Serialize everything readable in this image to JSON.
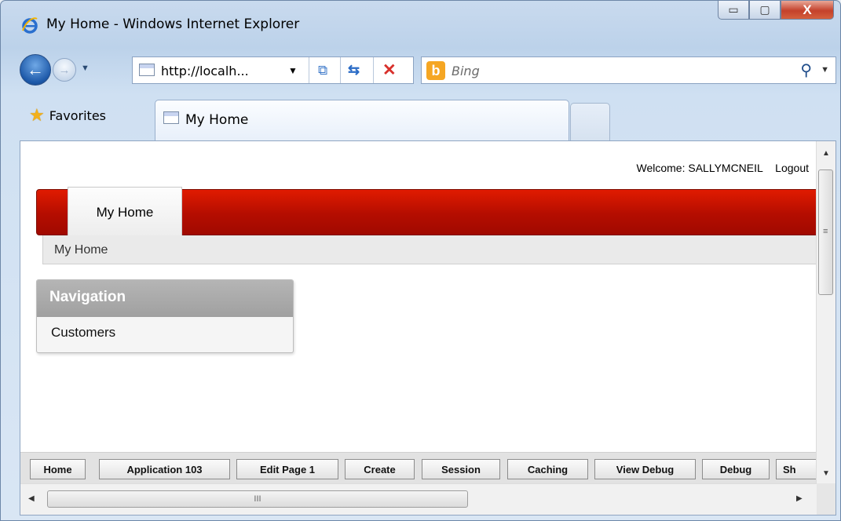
{
  "window": {
    "title": "My Home - Windows Internet Explorer",
    "controls": {
      "minimize": "▭",
      "maximize": "▢",
      "close": "X"
    }
  },
  "address_bar": {
    "url": "http://localh...",
    "icons": [
      "back-icon",
      "forward-icon",
      "compatibility-icon",
      "refresh-icon",
      "stop-icon"
    ]
  },
  "search": {
    "placeholder": "Bing",
    "brand": "b"
  },
  "favorites": {
    "label": "Favorites"
  },
  "tabs": [
    {
      "label": "My Home"
    }
  ],
  "page": {
    "welcome_text": "Welcome: SALLYMCNEIL",
    "logout_label": "Logout",
    "active_tab": "My Home",
    "breadcrumb": "My Home",
    "navigation": {
      "title": "Navigation",
      "items": [
        "Customers"
      ]
    }
  },
  "developer_toolbar": {
    "buttons": [
      "Home",
      "Application 103",
      "Edit Page 1",
      "Create",
      "Session",
      "Caching",
      "View Debug",
      "Debug",
      "Sh"
    ]
  },
  "scrollbar": {
    "grip": "≡",
    "h_grip": "III"
  },
  "colors": {
    "accent_red": "#c41200",
    "frame_blue": "#c9daee"
  }
}
